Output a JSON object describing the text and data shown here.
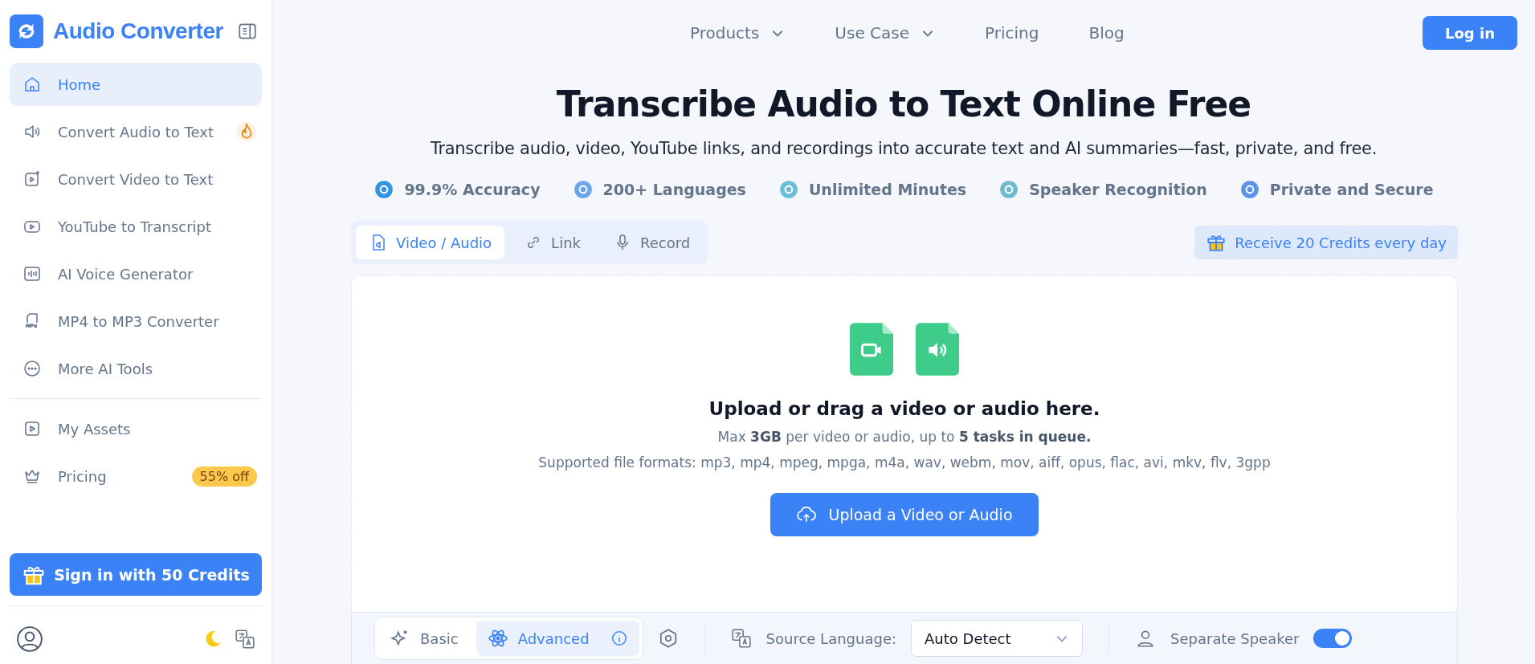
{
  "brand": {
    "name": "Audio Converter"
  },
  "sidebar": {
    "items": [
      {
        "label": "Home",
        "selected": true
      },
      {
        "label": "Convert Audio to Text",
        "selected": false,
        "hot": true
      },
      {
        "label": "Convert Video to Text",
        "selected": false
      },
      {
        "label": "YouTube to Transcript",
        "selected": false
      },
      {
        "label": "AI Voice Generator",
        "selected": false
      },
      {
        "label": "MP4 to MP3 Converter",
        "selected": false
      },
      {
        "label": "More AI Tools",
        "selected": false
      }
    ],
    "secondary_items": [
      {
        "label": "My Assets",
        "selected": false
      },
      {
        "label": "Pricing",
        "selected": false,
        "badge": "55% off"
      }
    ],
    "sign_in_button": "Sign in with 50 Credits"
  },
  "nav": {
    "items": [
      {
        "label": "Products",
        "dropdown": true
      },
      {
        "label": "Use Case",
        "dropdown": true
      },
      {
        "label": "Pricing",
        "dropdown": false
      },
      {
        "label": "Blog",
        "dropdown": false
      }
    ],
    "login_button": "Log in"
  },
  "hero": {
    "title": "Transcribe Audio to Text Online Free",
    "subtitle": "Transcribe audio, video, YouTube links, and recordings into accurate text and AI summaries—fast, private, and free.",
    "features": [
      "99.9% Accuracy",
      "200+ Languages",
      "Unlimited Minutes",
      "Speaker Recognition",
      "Private and Secure"
    ]
  },
  "input_tabs": [
    {
      "label": "Video / Audio",
      "selected": true
    },
    {
      "label": "Link",
      "selected": false
    },
    {
      "label": "Record",
      "selected": false
    }
  ],
  "credits_banner": "Receive 20 Credits every day",
  "upload": {
    "heading": "Upload or drag a video or audio here.",
    "limits": "Max **3GB** per video or audio, up to **5 tasks in queue.**",
    "formats": "Supported file formats: mp3, mp4, mpeg, mpga, m4a, wav, webm, mov, aiff, opus, flac, avi, mkv, flv, 3gpp",
    "button": "Upload a Video or Audio"
  },
  "options": {
    "modes": [
      {
        "label": "Basic",
        "selected": false
      },
      {
        "label": "Advanced",
        "selected": true
      }
    ],
    "source_language_label": "Source Language:",
    "source_language": "Auto Detect",
    "separate_speaker": {
      "label": "Separate Speaker",
      "on": true
    }
  }
}
